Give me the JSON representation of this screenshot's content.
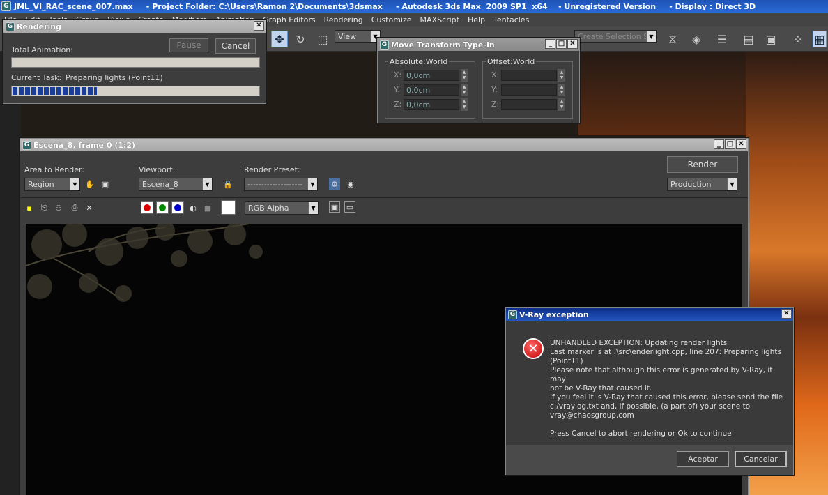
{
  "app": {
    "title": "JML_VI_RAC_scene_007.max     - Project Folder: C:\\Users\\Ramon 2\\Documents\\3dsmax     - Autodesk 3ds Max  2009 SP1  x64    - Unregistered Version     - Display : Direct 3D"
  },
  "menu": [
    "File",
    "Edit",
    "Tools",
    "Group",
    "Views",
    "Create",
    "Modifiers",
    "Animation",
    "Graph Editors",
    "Rendering",
    "Customize",
    "MAXScript",
    "Help",
    "Tentacles"
  ],
  "toolbar": {
    "view_combo": "View",
    "selection_set_placeholder": "Create Selection Set"
  },
  "rendering": {
    "title": "Rendering",
    "total_label": "Total Animation:",
    "pause": "Pause",
    "cancel": "Cancel",
    "task_label": "Current Task:",
    "task_value": "Preparing lights (Point11)",
    "progress": 0.34
  },
  "transform": {
    "title": "Move Transform Type-In",
    "absolute": "Absolute:World",
    "offset": "Offset:World",
    "x": "X:",
    "y": "Y:",
    "z": "Z:",
    "abs_x": "0,0cm",
    "abs_y": "0,0cm",
    "abs_z": "0,0cm"
  },
  "frame": {
    "title": "Escena_8, frame 0 (1:2)",
    "area_label": "Area to Render:",
    "area_value": "Region",
    "viewport_label": "Viewport:",
    "viewport_value": "Escena_8",
    "preset_label": "Render Preset:",
    "preset_value": "--------------------",
    "render_button": "Render",
    "mode_value": "Production",
    "channel_value": "RGB Alpha"
  },
  "vray": {
    "title": "V-Ray exception",
    "lines": [
      "UNHANDLED EXCEPTION: Updating render lights",
      "Last marker is at .\\src\\enderlight.cpp, line 207: Preparing lights",
      "(Point11)",
      "Please note that although this error is generated by V-Ray, it may",
      "not be V-Ray that caused it.",
      "If you feel it is V-Ray that caused this error, please send the file",
      "c:/vraylog.txt and, if possible, (a part of) your scene to",
      "vray@chaosgroup.com",
      "",
      "Press Cancel to abort rendering or Ok to continue"
    ],
    "ok": "Aceptar",
    "cancel": "Cancelar"
  }
}
